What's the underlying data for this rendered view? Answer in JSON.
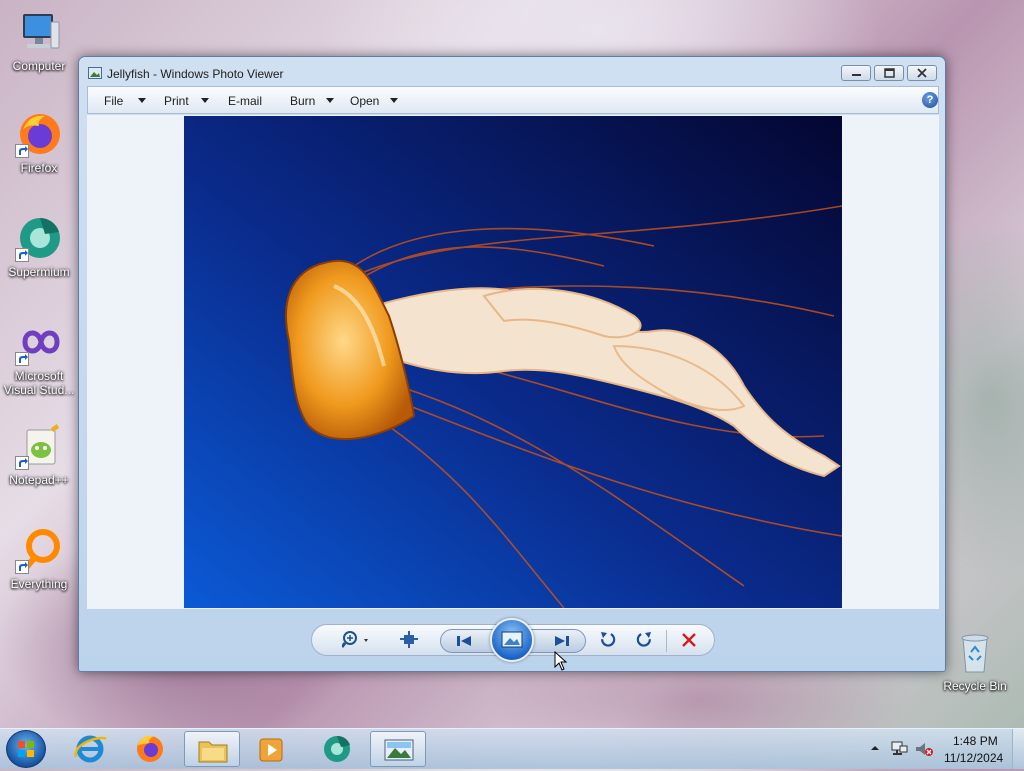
{
  "desktop": {
    "icons": [
      {
        "label": "Computer",
        "icon": "computer-icon"
      },
      {
        "label": "Firefox",
        "icon": "firefox-icon"
      },
      {
        "label": "Supermium",
        "icon": "supermium-icon"
      },
      {
        "label": "Microsoft Visual Stud...",
        "icon": "visual-studio-icon"
      },
      {
        "label": "Notepad++",
        "icon": "notepadpp-icon"
      },
      {
        "label": "Everything",
        "icon": "everything-icon"
      },
      {
        "label": "Recycle Bin",
        "icon": "recycle-bin-icon"
      }
    ]
  },
  "window": {
    "title": "Jellyfish - Windows Photo Viewer",
    "menu": [
      {
        "label": "File",
        "has_dropdown": true
      },
      {
        "label": "Print",
        "has_dropdown": true
      },
      {
        "label": "E-mail",
        "has_dropdown": false
      },
      {
        "label": "Burn",
        "has_dropdown": true
      },
      {
        "label": "Open",
        "has_dropdown": true
      }
    ],
    "help_symbol": "?",
    "photo_subject": "jellyfish",
    "controls": [
      "zoom",
      "actual-size",
      "previous",
      "slide-show",
      "next",
      "rotate-counterclockwise",
      "rotate-clockwise",
      "delete"
    ]
  },
  "taskbar": {
    "pinned": [
      "start-orb-icon",
      "internet-explorer-icon",
      "firefox-icon",
      "file-explorer-icon",
      "media-player-icon",
      "supermium-icon",
      "photo-viewer-icon"
    ],
    "clock": {
      "time": "1:48 PM",
      "date": "11/12/2024"
    }
  },
  "colors": {
    "accent": "#1f66c8",
    "delete": "#d01c1c",
    "photo_bg_top": "#050b3a",
    "photo_bg_bottom": "#0a48c4"
  }
}
